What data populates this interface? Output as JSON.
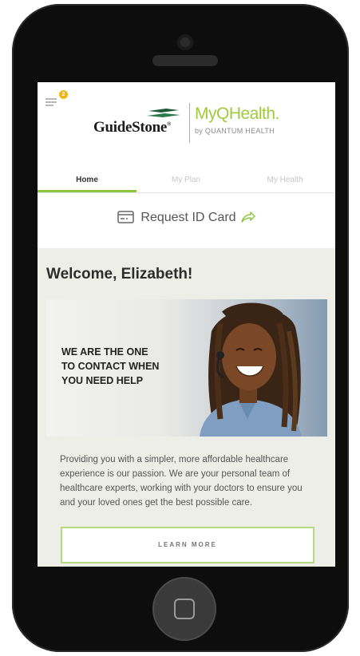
{
  "header": {
    "menu_badge": "2",
    "guidestone_logo": "GuideStone",
    "myqhealth_logo": "MyQHealth.",
    "quantum_tagline": "by QUANTUM HEALTH"
  },
  "tabs": [
    {
      "label": "Home",
      "active": true
    },
    {
      "label": "My Plan",
      "active": false
    },
    {
      "label": "My Health",
      "active": false
    }
  ],
  "request_id": {
    "label": "Request ID Card",
    "icon": "id-card-icon",
    "action_icon": "share-arrow-icon"
  },
  "welcome": "Welcome, Elizabeth!",
  "promo": {
    "line1": "WE ARE THE ONE",
    "line2": "TO CONTACT WHEN",
    "line3": "YOU NEED HELP"
  },
  "description": "Providing you with a simpler, more affordable healthcare experience is our passion. We are your personal team of healthcare experts, working with your doctors to ensure you and your loved ones get the best possible care.",
  "learn_more": "LEARN MORE",
  "colors": {
    "accent_green": "#8cc641",
    "badge_yellow": "#f3b715",
    "background_gray": "#eeeee9"
  }
}
